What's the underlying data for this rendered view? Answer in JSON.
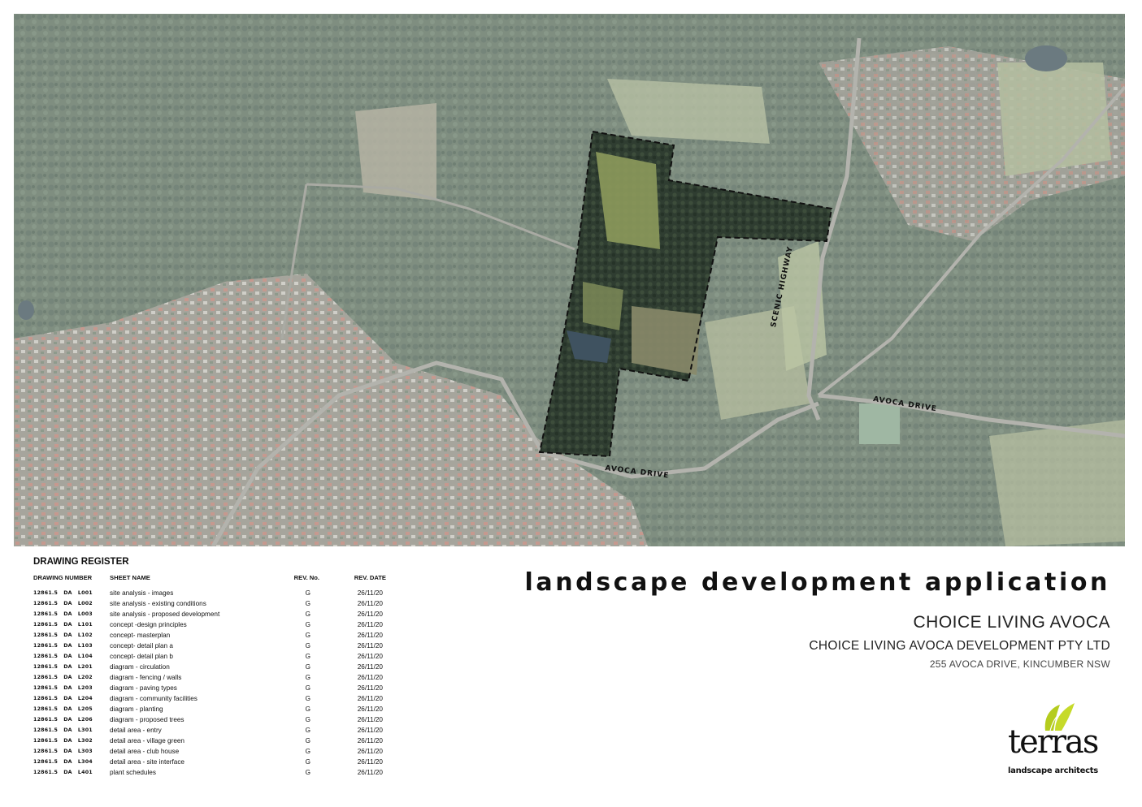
{
  "map": {
    "road_labels": {
      "scenic_highway": "SCENIC HIGHWAY",
      "avoca_drive_east": "AVOCA DRIVE",
      "avoca_drive_south": "AVOCA DRIVE"
    },
    "colors": {
      "forest": "#7f8e80",
      "suburb": "#a6a49c",
      "field": "#b8c0a4",
      "site_dark": "#2e3b30",
      "site_field": "#8d9a5c",
      "boundary": "#111111"
    }
  },
  "register": {
    "title": "DRAWING REGISTER",
    "headers": {
      "number": "DRAWING NUMBER",
      "name": "SHEET NAME",
      "rev": "REV. No.",
      "date": "REV. DATE"
    },
    "rows": [
      {
        "number": "12861.5   DA   L001",
        "name": "site analysis - images",
        "rev": "G",
        "date": "26/11/20"
      },
      {
        "number": "12861.5   DA   L002",
        "name": "site analysis - existing conditions",
        "rev": "G",
        "date": "26/11/20"
      },
      {
        "number": "12861.5   DA   L003",
        "name": "site analysis - proposed development",
        "rev": "G",
        "date": "26/11/20"
      },
      {
        "number": "12861.5   DA   L101",
        "name": "concept -design principles",
        "rev": "G",
        "date": "26/11/20"
      },
      {
        "number": "12861.5   DA   L102",
        "name": "concept- masterplan",
        "rev": "G",
        "date": "26/11/20"
      },
      {
        "number": "12861.5   DA   L103",
        "name": "concept- detail plan a",
        "rev": "G",
        "date": "26/11/20"
      },
      {
        "number": "12861.5   DA   L104",
        "name": "concept- detail plan b",
        "rev": "G",
        "date": "26/11/20"
      },
      {
        "number": "12861.5   DA   L201",
        "name": "diagram - circulation",
        "rev": "G",
        "date": "26/11/20"
      },
      {
        "number": "12861.5   DA   L202",
        "name": "diagram - fencing / walls",
        "rev": "G",
        "date": "26/11/20"
      },
      {
        "number": "12861.5   DA   L203",
        "name": "diagram - paving types",
        "rev": "G",
        "date": "26/11/20"
      },
      {
        "number": "12861.5   DA   L204",
        "name": "diagram - community facilities",
        "rev": "G",
        "date": "26/11/20"
      },
      {
        "number": "12861.5   DA   L205",
        "name": "diagram - planting",
        "rev": "G",
        "date": "26/11/20"
      },
      {
        "number": "12861.5   DA   L206",
        "name": "diagram - proposed trees",
        "rev": "G",
        "date": "26/11/20"
      },
      {
        "number": "12861.5   DA   L301",
        "name": "detail area - entry",
        "rev": "G",
        "date": "26/11/20"
      },
      {
        "number": "12861.5   DA   L302",
        "name": "detail area - village green",
        "rev": "G",
        "date": "26/11/20"
      },
      {
        "number": "12861.5   DA   L303",
        "name": "detail area - club house",
        "rev": "G",
        "date": "26/11/20"
      },
      {
        "number": "12861.5   DA   L304",
        "name": "detail area - site interface",
        "rev": "G",
        "date": "26/11/20"
      },
      {
        "number": "12861.5   DA   L401",
        "name": "plant schedules",
        "rev": "G",
        "date": "26/11/20"
      }
    ]
  },
  "title_block": {
    "title": "landscape development application",
    "project": "CHOICE LIVING AVOCA",
    "client": "CHOICE LIVING AVOCA DEVELOPMENT PTY LTD",
    "address": "255 AVOCA DRIVE, KINCUMBER NSW"
  },
  "logo": {
    "word": "terras",
    "tagline": "landscape architects",
    "leaf_color": "#b5cc1e"
  }
}
